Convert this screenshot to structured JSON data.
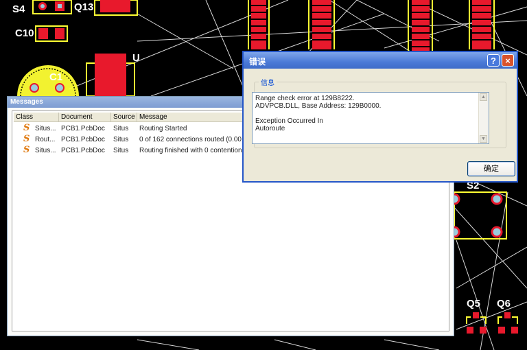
{
  "pcb": {
    "designators": [
      "S4",
      "Q13",
      "C10",
      "C1",
      "U",
      "S2",
      "Q5",
      "Q6"
    ]
  },
  "messages_panel": {
    "title": "Messages",
    "columns": [
      "Class",
      "Document",
      "Source",
      "Message"
    ],
    "rows": [
      {
        "class": "Situs...",
        "document": "PCB1.PcbDoc",
        "source": "Situs",
        "message": "Routing Started"
      },
      {
        "class": "Rout...",
        "document": "PCB1.PcbDoc",
        "source": "Situs",
        "message": "0 of 162 connections routed (0.00"
      },
      {
        "class": "Situs...",
        "document": "PCB1.PcbDoc",
        "source": "Situs",
        "message": "Routing finished  with 0 contention"
      }
    ],
    "row_icon": "situs-s-icon"
  },
  "dialog": {
    "title": "错误",
    "help_icon": "?",
    "close_icon": "×",
    "group_label": "信息",
    "text_lines": [
      "Range check error at 129B8222.",
      "ADVPCB.DLL, Base Address: 129B0000.",
      "",
      "Exception Occurred In",
      "Autoroute"
    ],
    "ok_label": "确定"
  },
  "colors": {
    "pcb_background": "#000000",
    "pad_red": "#e8192c",
    "silkscreen_yellow": "#ffff33",
    "rat_lines": "#d8d8d8",
    "titlebar_blue": "#3e6cc9"
  }
}
